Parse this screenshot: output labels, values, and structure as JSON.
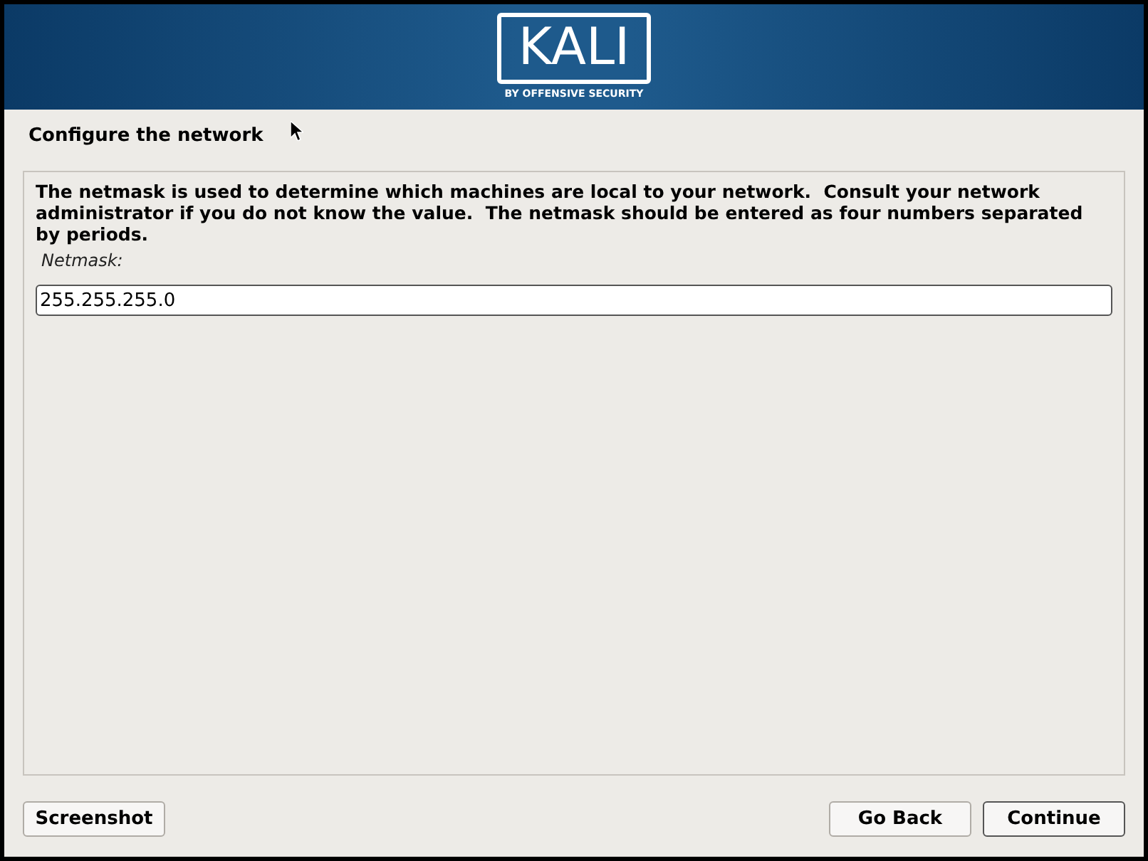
{
  "banner": {
    "logo": "KALI",
    "tagline": "BY OFFENSIVE SECURITY"
  },
  "title": "Configure the network",
  "description": "The netmask is used to determine which machines are local to your network.  Consult your network administrator if you do not know the value.  The netmask should be entered as four numbers separated by periods.",
  "field": {
    "label": "Netmask:",
    "value": "255.255.255.0"
  },
  "left_buttons": [
    {
      "label": "Screenshot",
      "default": false
    }
  ],
  "right_buttons": [
    {
      "label": "Go Back",
      "default": false
    },
    {
      "label": "Continue",
      "default": true
    }
  ]
}
